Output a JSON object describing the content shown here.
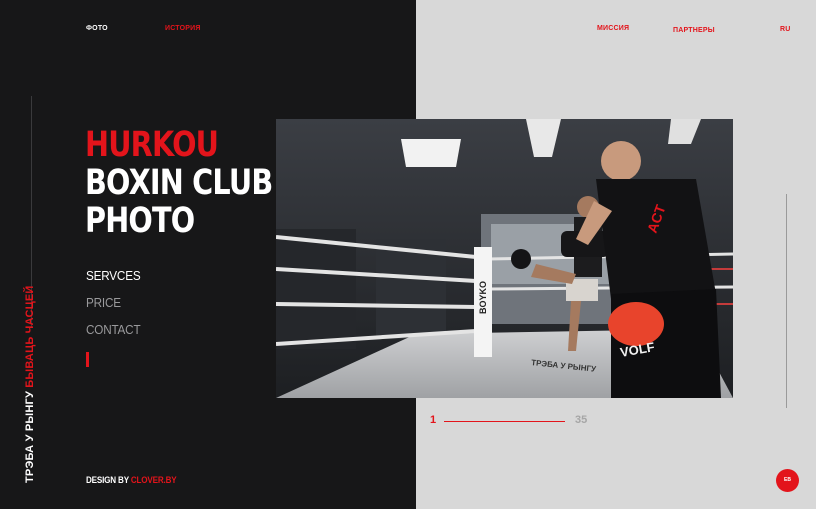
{
  "nav": {
    "photo": "ФОТО",
    "history": "ИСТОРИЯ",
    "mission": "МИССИЯ",
    "partners": "ПАРТНЕРЫ",
    "lang": "RU"
  },
  "hero": {
    "title_line1": "HURKOU",
    "title_line2": "BOXIN CLUB",
    "title_line3": "PHOTO"
  },
  "menu": {
    "items": [
      {
        "label": "SERVCES",
        "active": true
      },
      {
        "label": "PRICE",
        "active": false
      },
      {
        "label": "CONTACT",
        "active": false
      }
    ]
  },
  "slogan": {
    "white_part": "ТРЭБА У РЫНГУ",
    "red_part": "БЫВАЦЬ ЧАСЦЕЙ"
  },
  "footer": {
    "design_prefix": "DESIGN BY",
    "design_link": "CLOVER.BY"
  },
  "pager": {
    "current": "1",
    "total": "35"
  },
  "lang_button": "EB",
  "photo": {
    "ring_sign": "ТРЭБА У РЫНГУ",
    "post_logo": "BOYKO",
    "shorts_logo": "VOLF",
    "shirt_logo": "ACT"
  },
  "colors": {
    "accent": "#e3141b",
    "dark_panel": "#171718",
    "light_panel": "#d8d8d8"
  }
}
